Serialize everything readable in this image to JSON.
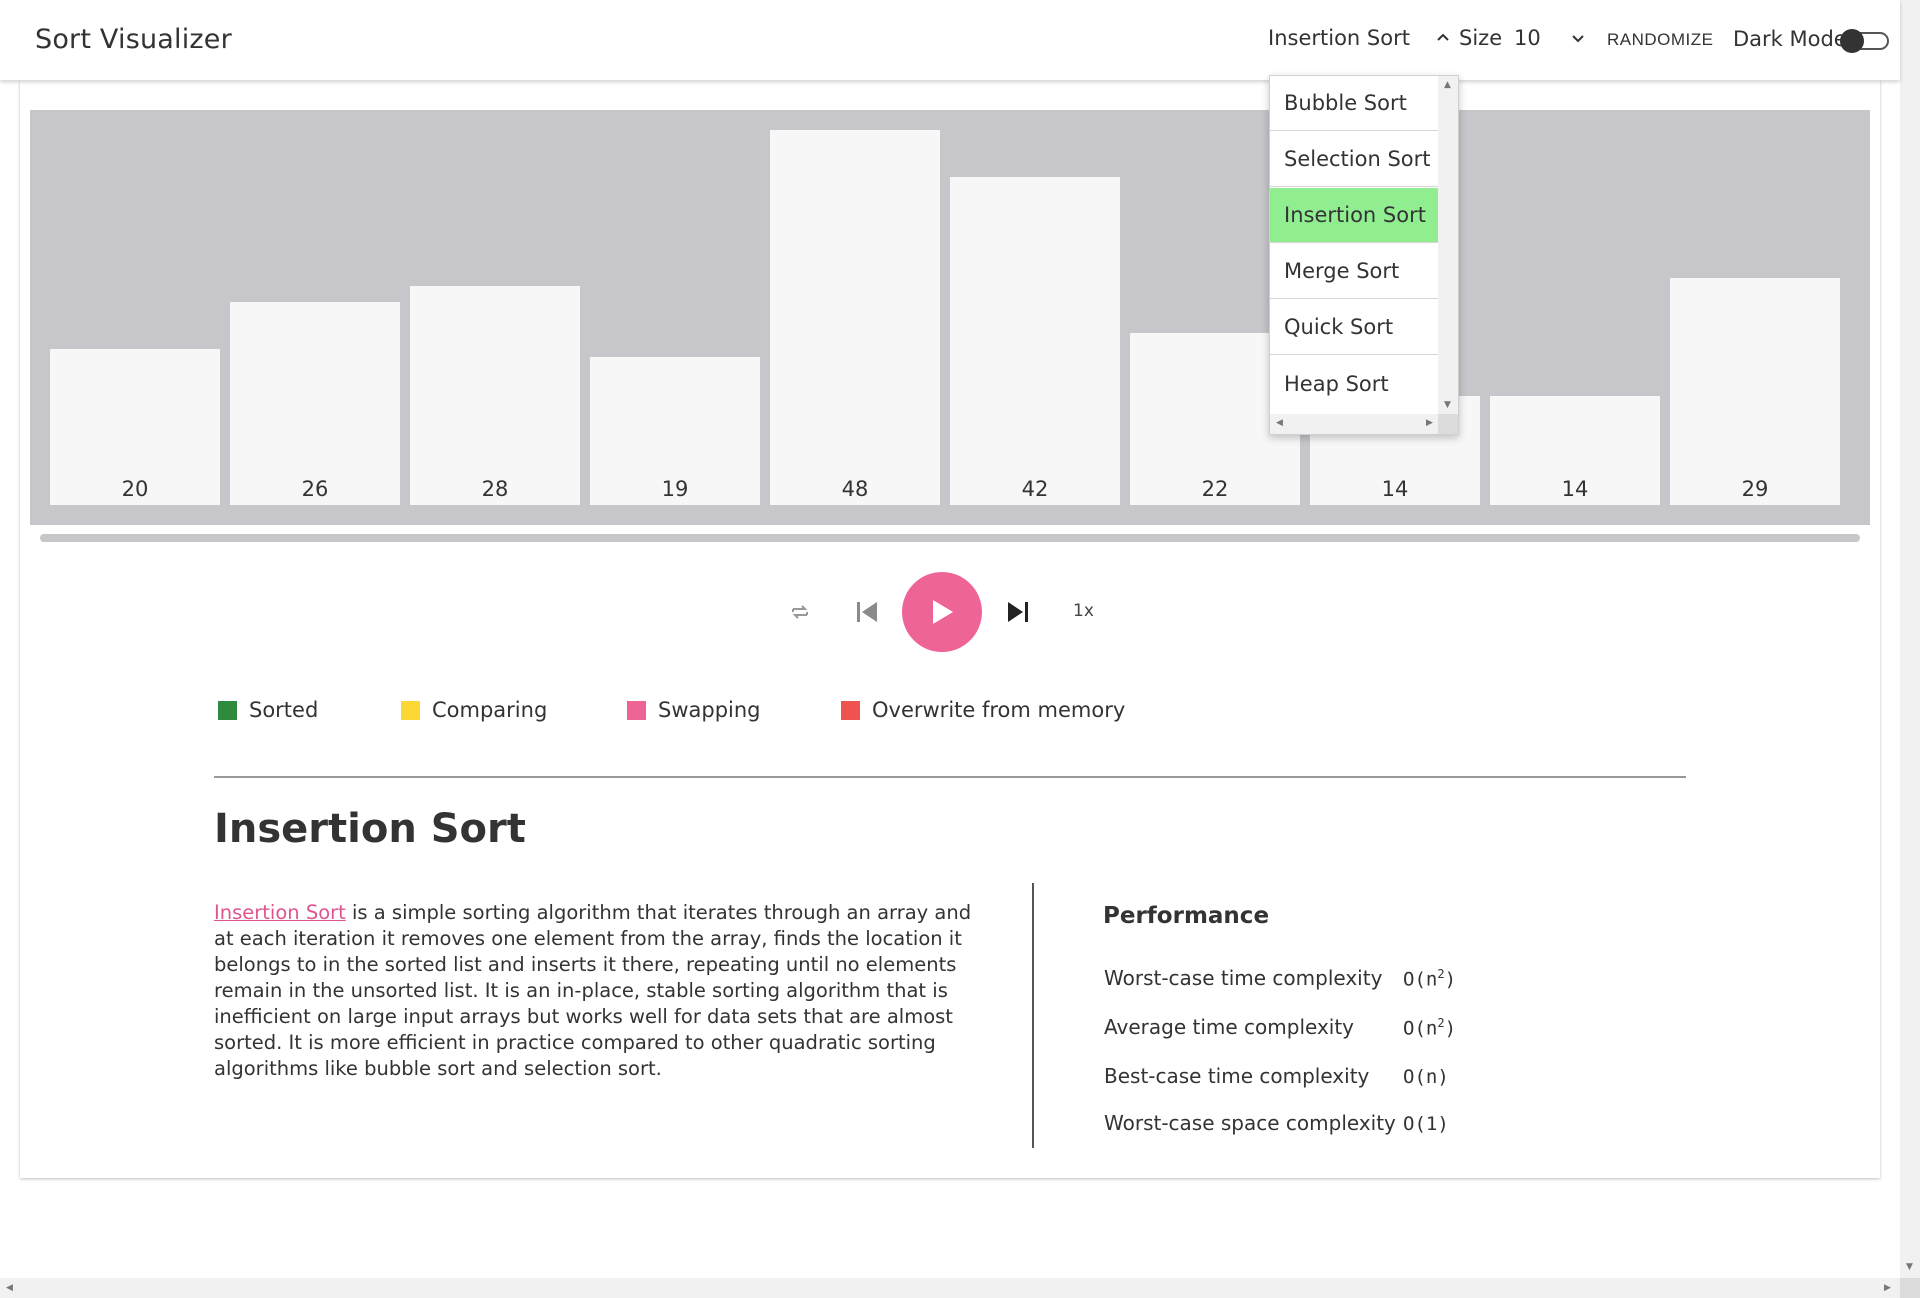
{
  "app": {
    "title": "Sort Visualizer",
    "algorithm_selected": "Insertion Sort",
    "size_label": "Size",
    "size_value": "10",
    "randomize_label": "RANDOMIZE",
    "dark_mode_label": "Dark Mode",
    "dark_mode_on": false
  },
  "dropdown": {
    "options": [
      "Bubble Sort",
      "Selection Sort",
      "Insertion Sort",
      "Merge Sort",
      "Quick Sort",
      "Heap Sort"
    ],
    "selected": "Insertion Sort"
  },
  "array": {
    "values": [
      20,
      26,
      28,
      19,
      48,
      42,
      22,
      14,
      14,
      29
    ],
    "bar_color": "#f7f7f7",
    "background_color": "#c6c6cb"
  },
  "playback": {
    "speed": "1x",
    "progress": 0,
    "play_color": "#ef6497"
  },
  "legend": [
    {
      "label": "Sorted",
      "color": "#2e8b3d"
    },
    {
      "label": "Comparing",
      "color": "#fdd835"
    },
    {
      "label": "Swapping",
      "color": "#ef6497"
    },
    {
      "label": "Overwrite from memory",
      "color": "#ef5350"
    }
  ],
  "info": {
    "heading": "Insertion Sort",
    "link_text": "Insertion Sort",
    "description": " is a simple sorting algorithm that iterates through an array and at each iteration it removes one element from the array, finds the location it belongs to in the sorted list and inserts it there, repeating until no elements remain in the unsorted list. It is an in-place, stable sorting algorithm that is inefficient on large input arrays but works well for data sets that are almost sorted. It is more efficient in practice compared to other quadratic sorting algorithms like bubble sort and selection sort.",
    "performance_title": "Performance",
    "performance": [
      {
        "label": "Worst-case time complexity",
        "base": "O(n",
        "sup": "2",
        "tail": ")"
      },
      {
        "label": "Average time complexity",
        "base": "O(n",
        "sup": "2",
        "tail": ")"
      },
      {
        "label": "Best-case time complexity",
        "base": "O(n)",
        "sup": "",
        "tail": ""
      },
      {
        "label": "Worst-case space complexity",
        "base": "O(1)",
        "sup": "",
        "tail": ""
      }
    ]
  }
}
